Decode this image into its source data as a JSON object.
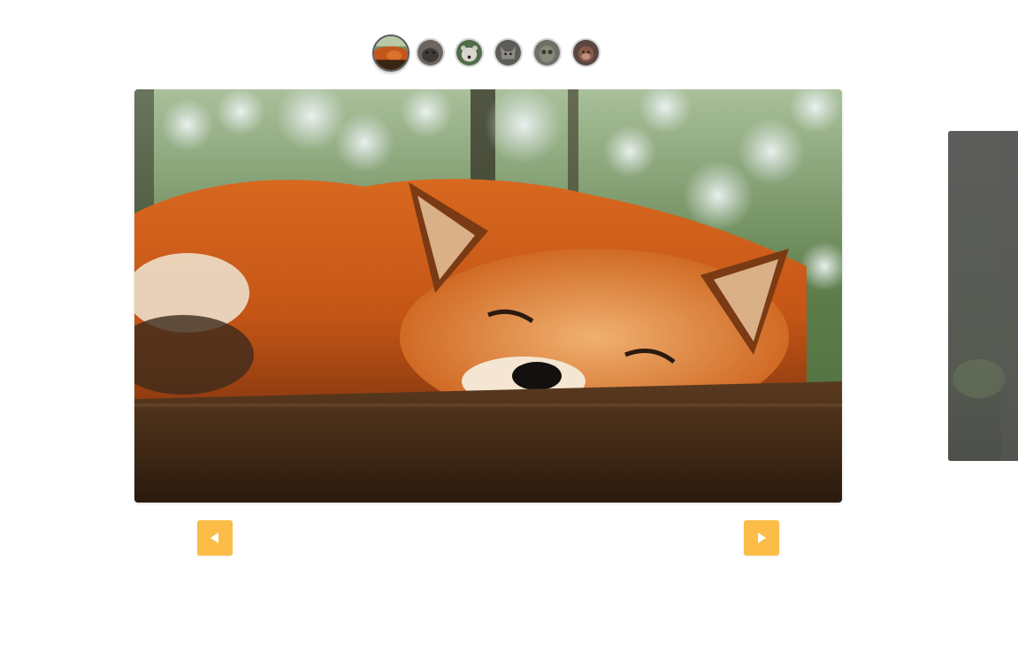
{
  "colors": {
    "background": "#ffffff",
    "arrow_bg": "#fbbd47",
    "arrow_icon": "#ffffff",
    "thumb_active_border": "#5a5a5a",
    "thumb_border": "#d6d6d6"
  },
  "gallery": {
    "active_index": 0,
    "thumbnails": [
      {
        "icon": "fox-thumbnail",
        "active": true
      },
      {
        "icon": "animal-thumbnail-2",
        "active": false
      },
      {
        "icon": "bear-thumbnail",
        "active": false
      },
      {
        "icon": "wolf-thumbnail",
        "active": false
      },
      {
        "icon": "owl-thumbnail",
        "active": false
      },
      {
        "icon": "monkey-thumbnail",
        "active": false
      }
    ],
    "main_image": "sleeping-fox-photo",
    "next_image": "next-slide-photo"
  },
  "controls": {
    "prev_icon": "triangle-left-icon",
    "next_icon": "triangle-right-icon"
  }
}
